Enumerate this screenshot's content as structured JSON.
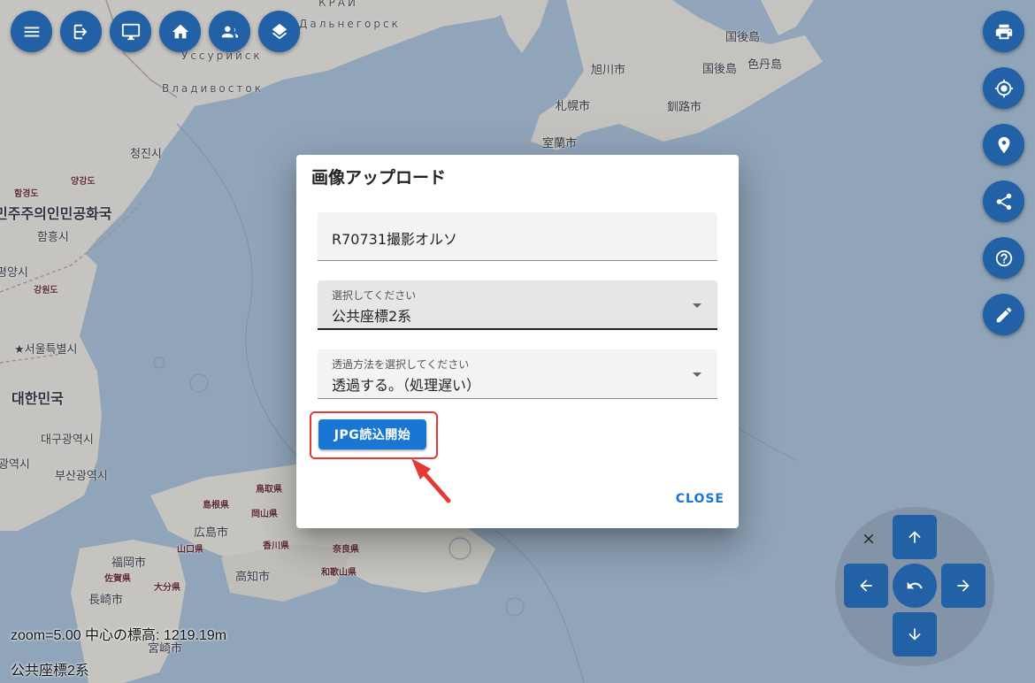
{
  "map": {
    "labels": {
      "krai": "КРАЙ",
      "dalnegorsk": "Дальнегорск",
      "ussuriysk": "Уссурийск",
      "vladivostok": "Владивосток",
      "cheongjin": "청진시",
      "nk_name": "민주주의인민공화국",
      "hamheung": "함흥시",
      "yangyang": "양강도",
      "hamgyong": "함경도",
      "gangwon_n": "강원도",
      "pyongyang": "평양시",
      "seoul": "★서울특별시",
      "sk_name": "대한민국",
      "daegu": "대구광역시",
      "busan": "부산광역시",
      "gwangju": "광역시",
      "asahikawa": "旭川市",
      "sapporo": "札幌市",
      "kushiro": "釧路市",
      "muroran": "室蘭市",
      "kunashiri": "国後島",
      "kunashiri2": "国後島",
      "shikotan": "色丹島",
      "tottori": "鳥取県",
      "shimane": "島根県",
      "okayama": "岡山県",
      "hiroshima": "広島市",
      "kagawa": "香川県",
      "kochi": "高知市",
      "nara": "奈良県",
      "wakayama": "和歌山県",
      "fukuoka": "福岡市",
      "saga": "佐賀県",
      "oita": "大分県",
      "nagasaki": "長崎市",
      "miyazaki": "宮崎市",
      "yamaguchi": "山口県"
    }
  },
  "toolbar": {
    "left_icons": [
      "menu-icon",
      "login-icon",
      "monitor-icon",
      "home-icon",
      "group-icon",
      "layers-icon"
    ],
    "right_icons": [
      "print-icon",
      "gps-icon",
      "location-pin-icon",
      "share-icon",
      "help-icon",
      "edit-icon"
    ]
  },
  "status": {
    "zoom": "zoom=5.00 中心の標高: 1219.19m",
    "coord_system": "公共座標2系"
  },
  "dialog": {
    "title": "画像アップロード",
    "name_value": "R70731撮影オルソ",
    "coord_label": "選択してください",
    "coord_value": "公共座標2系",
    "trans_label": "透過方法を選択してください",
    "trans_value": "透過する。（処理遅い）",
    "start_button": "JPG読込開始",
    "close_button": "CLOSE"
  },
  "colors": {
    "primary": "#1976d2",
    "fab": "#2261a6",
    "highlight": "#e53935"
  }
}
